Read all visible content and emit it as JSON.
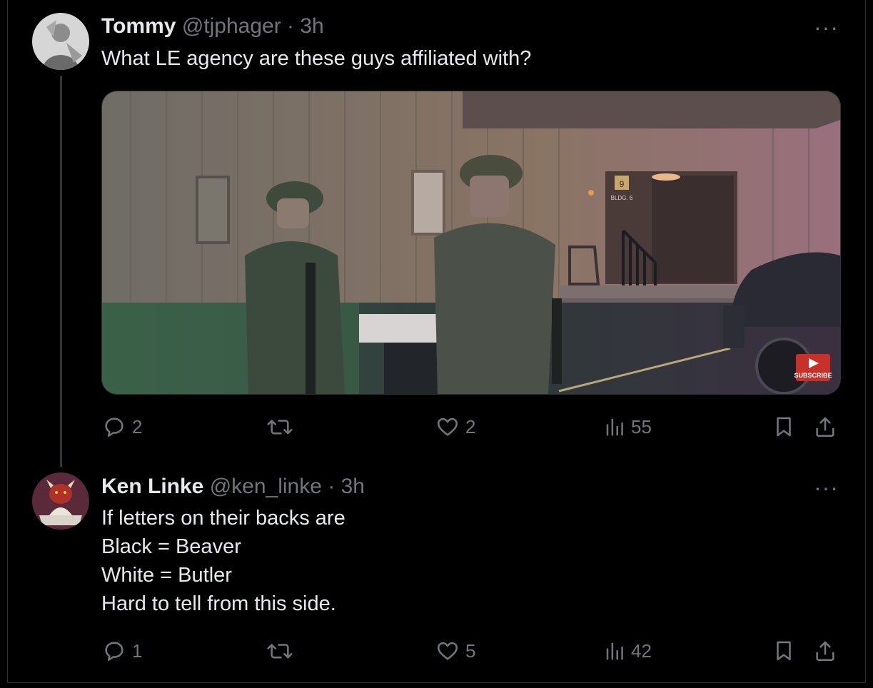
{
  "tweets": [
    {
      "name": "Tommy",
      "handle": "@tjphager",
      "separator": "·",
      "time": "3h",
      "text_lines": [
        "What LE agency are these guys affiliated with?"
      ],
      "media": {
        "overlay_label": "SUBSCRIBE",
        "sign_number": "9",
        "sign_text": "BLDG. 6"
      },
      "actions": {
        "replies": "2",
        "retweets": "",
        "likes": "2",
        "views": "55"
      },
      "more_label": "···"
    },
    {
      "name": "Ken Linke",
      "handle": "@ken_linke",
      "separator": "·",
      "time": "3h",
      "text_lines": [
        "If letters on their backs are",
        "Black = Beaver",
        "White = Butler",
        "Hard to tell from this side."
      ],
      "actions": {
        "replies": "1",
        "retweets": "",
        "likes": "5",
        "views": "42"
      },
      "more_label": "···"
    }
  ],
  "icons": {
    "reply": "reply-icon",
    "retweet": "retweet-icon",
    "like": "heart-icon",
    "views": "views-icon",
    "bookmark": "bookmark-icon",
    "share": "share-icon",
    "more": "more-icon"
  },
  "colors": {
    "background": "#000000",
    "text": "#e7e9ea",
    "muted": "#71767b",
    "border": "#2f3336"
  }
}
